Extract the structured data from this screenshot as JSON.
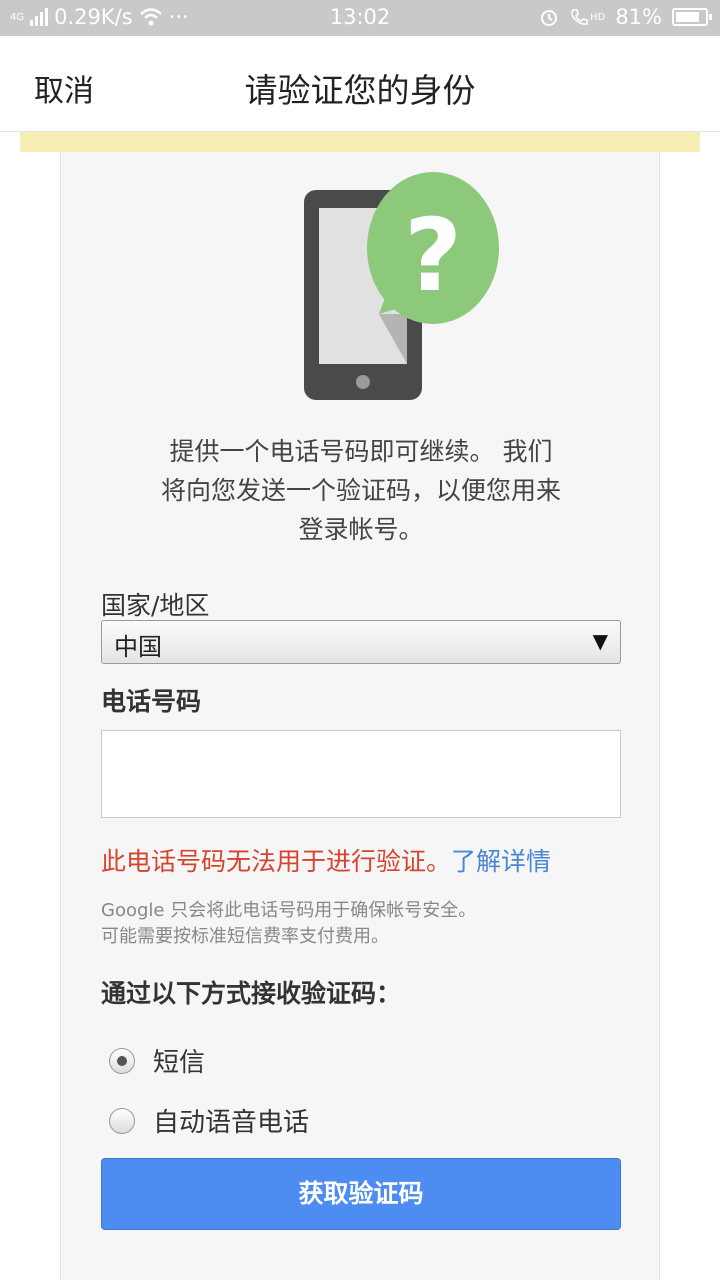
{
  "status_bar": {
    "network": "4G",
    "speed": "0.29K/s",
    "dots": "···",
    "time": "13:02",
    "hd": "HD",
    "battery": "81%",
    "battery_level": 0.81
  },
  "nav": {
    "cancel_label": "取消",
    "title": "请验证您的身份"
  },
  "illustration": {
    "question_mark": "?"
  },
  "intro": {
    "line1": "提供一个电话号码即可继续。 我们",
    "line2": "将向您发送一个验证码，以便您用来",
    "line3": "登录帐号。"
  },
  "form": {
    "country_label": "国家/地区",
    "country_value": "中国",
    "phone_label": "电话号码",
    "phone_value": "",
    "error_text": "此电话号码无法用于进行验证。",
    "learn_more": "了解详情",
    "note_line1": "Google 只会将此电话号码用于确保帐号安全。",
    "note_line2": "可能需要按标准短信费率支付费用。",
    "method_title": "通过以下方式接收验证码：",
    "options": [
      {
        "label": "短信",
        "checked": true
      },
      {
        "label": "自动语音电话",
        "checked": false
      }
    ],
    "submit_label": "获取验证码"
  },
  "colors": {
    "accent": "#4d8cf0",
    "error": "#d6442f",
    "link": "#4a86d6",
    "bubble": "#8cc97a"
  }
}
